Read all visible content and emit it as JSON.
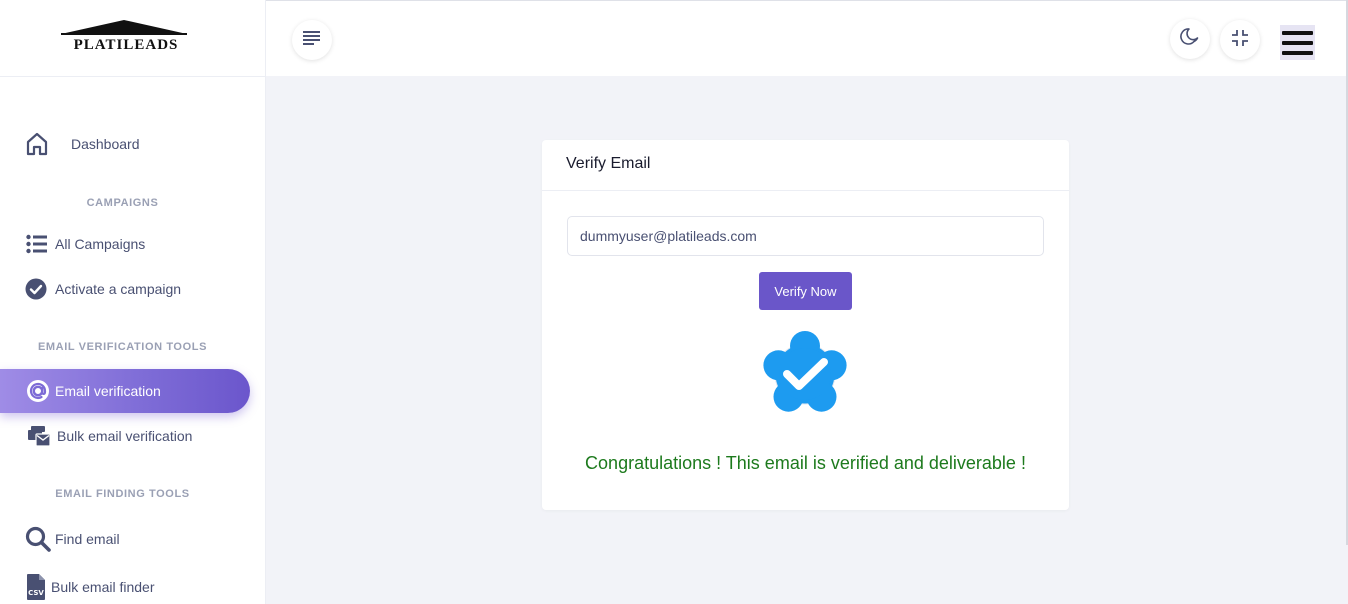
{
  "brand": {
    "logo_text": "PLATILEADS"
  },
  "sidebar": {
    "dashboard": {
      "label": "Dashboard",
      "icon": "home-icon"
    },
    "sections": {
      "campaigns": "CAMPAIGNS",
      "email_verification_tools": "EMAIL VERIFICATION TOOLS",
      "email_finding_tools": "EMAIL FINDING TOOLS"
    },
    "items": {
      "all_campaigns": {
        "label": "All Campaigns",
        "icon": "list-icon"
      },
      "activate_campaign": {
        "label": "Activate a campaign",
        "icon": "check-circle-icon"
      },
      "email_verification": {
        "label": "Email verification",
        "icon": "at-sign-icon",
        "active": true
      },
      "bulk_email_verification": {
        "label": "Bulk email verification",
        "icon": "mail-bulk-icon"
      },
      "find_email": {
        "label": "Find email",
        "icon": "search-icon"
      },
      "bulk_email_finder": {
        "label": "Bulk email finder",
        "icon": "csv-file-icon"
      }
    }
  },
  "topbar": {
    "menu_toggle": "menu-lines-icon",
    "dark_mode": "moon-icon",
    "fullscreen": "compress-icon",
    "hamburger": "hamburger-icon"
  },
  "card": {
    "title": "Verify Email",
    "email_value": "dummyuser@platileads.com",
    "verify_button": "Verify Now",
    "badge_icon": "verified-badge-icon",
    "success_message": "Congratulations ! This email is verified and deliverable !"
  },
  "colors": {
    "accent": "#6a56c9",
    "success_text": "#1d7a1d",
    "badge_blue": "#1d9bf0",
    "background": "#f2f3f8"
  }
}
